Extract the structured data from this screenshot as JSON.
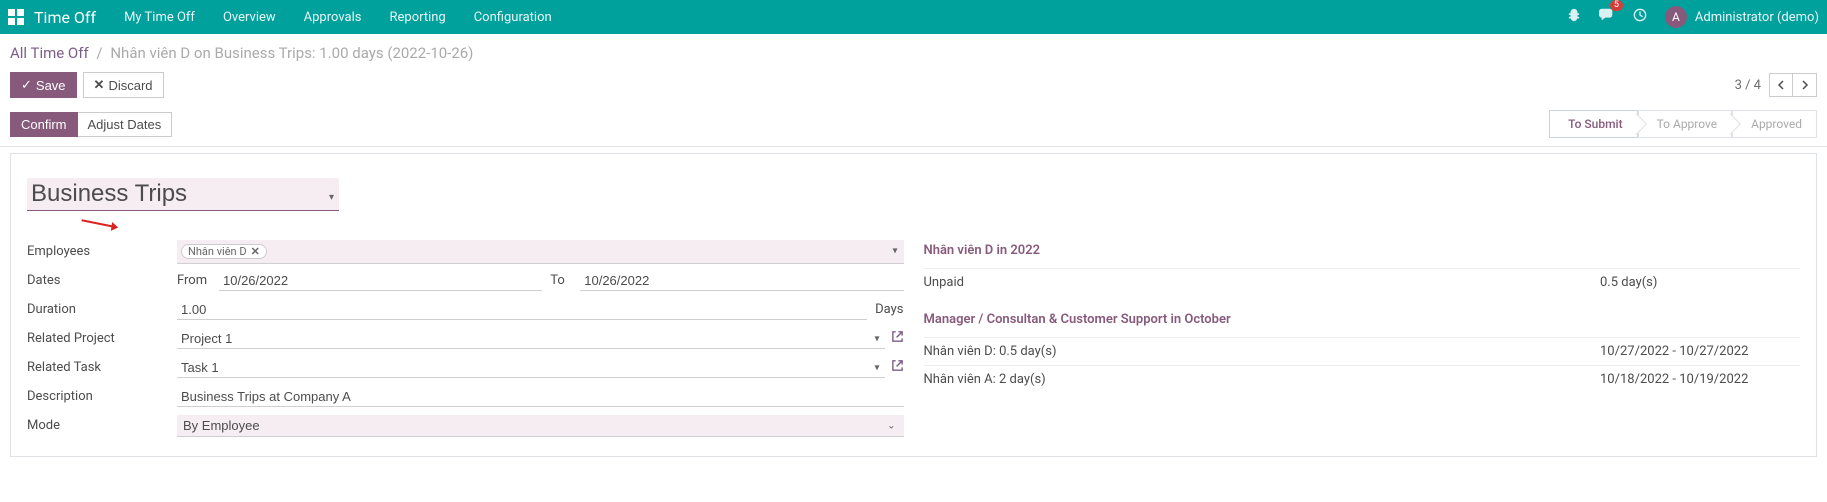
{
  "nav": {
    "app_title": "Time Off",
    "items": [
      "My Time Off",
      "Overview",
      "Approvals",
      "Reporting",
      "Configuration"
    ],
    "inbox_badge": "5",
    "user_initial": "A",
    "user_name": "Administrator (demo)"
  },
  "breadcrumb": {
    "root": "All Time Off",
    "current": "Nhân viên D on Business Trips: 1.00 days (2022-10-26)"
  },
  "actions": {
    "save": "Save",
    "discard": "Discard",
    "pager": "3 / 4",
    "confirm": "Confirm",
    "adjust": "Adjust Dates"
  },
  "stages": {
    "to_submit": "To Submit",
    "to_approve": "To Approve",
    "approved": "Approved"
  },
  "form": {
    "title": "Business Trips",
    "labels": {
      "employees": "Employees",
      "dates": "Dates",
      "from": "From",
      "to": "To",
      "duration": "Duration",
      "duration_unit": "Days",
      "related_project": "Related Project",
      "related_task": "Related Task",
      "description": "Description",
      "mode": "Mode"
    },
    "employees_tag": "Nhân viên D",
    "date_from": "10/26/2022",
    "date_to": "10/26/2022",
    "duration": "1.00",
    "related_project": "Project 1",
    "related_task": "Task 1",
    "description": "Business Trips at Company A",
    "mode": "By Employee"
  },
  "summary": {
    "section1_title": "Nhân viên D in 2022",
    "row1_label": "Unpaid",
    "row1_value": "0.5 day(s)",
    "section2_title": "Manager / Consultan & Customer Support in October",
    "row2_label": "Nhân viên D: 0.5 day(s)",
    "row2_value": "10/27/2022 - 10/27/2022",
    "row3_label": "Nhân viên A: 2 day(s)",
    "row3_value": "10/18/2022 - 10/19/2022"
  }
}
